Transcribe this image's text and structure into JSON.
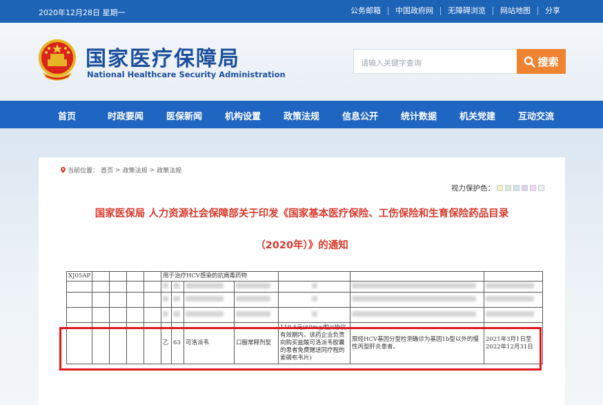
{
  "topbar": {
    "date": "2020年12月28日 星期一",
    "links": [
      "公务邮箱",
      "中国政府网",
      "无障碍浏览",
      "网站地图",
      "分享"
    ]
  },
  "header": {
    "title_cn": "国家医疗保障局",
    "title_en": "National Healthcare Security Administration",
    "search_placeholder": "请输入关键字查询",
    "search_button": "搜索"
  },
  "nav": {
    "items": [
      "首页",
      "时政要闻",
      "医保新闻",
      "机构设置",
      "政策法规",
      "信息公开",
      "统计数据",
      "机关党建",
      "互动交流"
    ]
  },
  "breadcrumb": {
    "label": "当前位置：",
    "items": [
      "首页",
      "政策法规",
      "政策法规"
    ]
  },
  "vision": {
    "label": "视力保护色：",
    "colors": [
      "#f4f4c6",
      "#d8ecd8",
      "#cde6f2",
      "#d9d6f0",
      "#f0d6ee",
      "#f0f0f0"
    ]
  },
  "article": {
    "title_line1": "国家医保局 人力资源社会保障部关于印发《国家基本医疗保险、工伤保险和生育保险药品目录",
    "title_line2": "（2020年）》的通知"
  },
  "table": {
    "header_code": "XJ05AP",
    "header_category": "用于治疗HCV感染的抗病毒药物",
    "row": {
      "class": "乙",
      "number": "63",
      "drug": "可洛派韦",
      "form": "口服常释剂型",
      "price": "119.5元(60mg/粒)(协议有效期内，该药企业负责向购买盐酸可洛派韦胶囊的患者免费赠送同疗程的索磷布韦片)",
      "restriction": "限经HCV基因分型检测确诊为基因1b型以外的慢性丙型肝炎患者。",
      "period": "2021年3月1日至2022年12月31日"
    }
  },
  "colors": {
    "topbar": "#1d63b6",
    "nav": "#1f66c2",
    "search_button": "#ef8332",
    "title_red": "#d63a2c",
    "highlight": "#e0151b"
  }
}
